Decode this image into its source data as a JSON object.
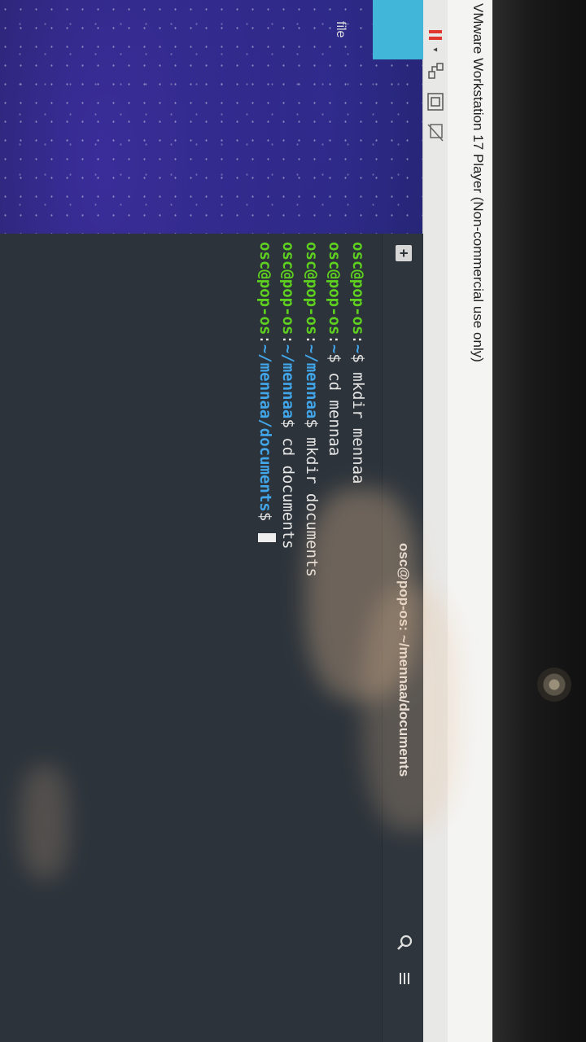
{
  "window": {
    "title": "VMware Workstation 17 Player (Non-commercial use only)"
  },
  "toolbar": {
    "icons": [
      "pause-icon",
      "chevron-down-icon",
      "vm-settings-icon",
      "fit-window-icon",
      "unity-disabled-icon"
    ],
    "pause_color": "#e0362b"
  },
  "desktop": {
    "file_label": "file",
    "accent_color": "#41b6d8"
  },
  "terminal": {
    "title": "osc@pop-os: ~/mennaa/documents",
    "new_tab_symbol": "+",
    "colors": {
      "user": "#5ed01f",
      "path": "#41a6ea",
      "text": "#e6e6e6",
      "background": "#2c333a"
    },
    "lines": [
      {
        "user": "osc@pop-os",
        "sep": ":",
        "path": "~",
        "prompt": "$ ",
        "cmd": "mkdir mennaa"
      },
      {
        "user": "osc@pop-os",
        "sep": ":",
        "path": "~",
        "prompt": "$ ",
        "cmd": "cd mennaa"
      },
      {
        "user": "osc@pop-os",
        "sep": ":",
        "path": "~/mennaa",
        "prompt": "$ ",
        "cmd": "mkdir documents"
      },
      {
        "user": "osc@pop-os",
        "sep": ":",
        "path": "~/mennaa",
        "prompt": "$ ",
        "cmd": "cd documents"
      },
      {
        "user": "osc@pop-os",
        "sep": ":",
        "path": "~/mennaa/documents",
        "prompt": "$ ",
        "cmd": ""
      }
    ]
  }
}
